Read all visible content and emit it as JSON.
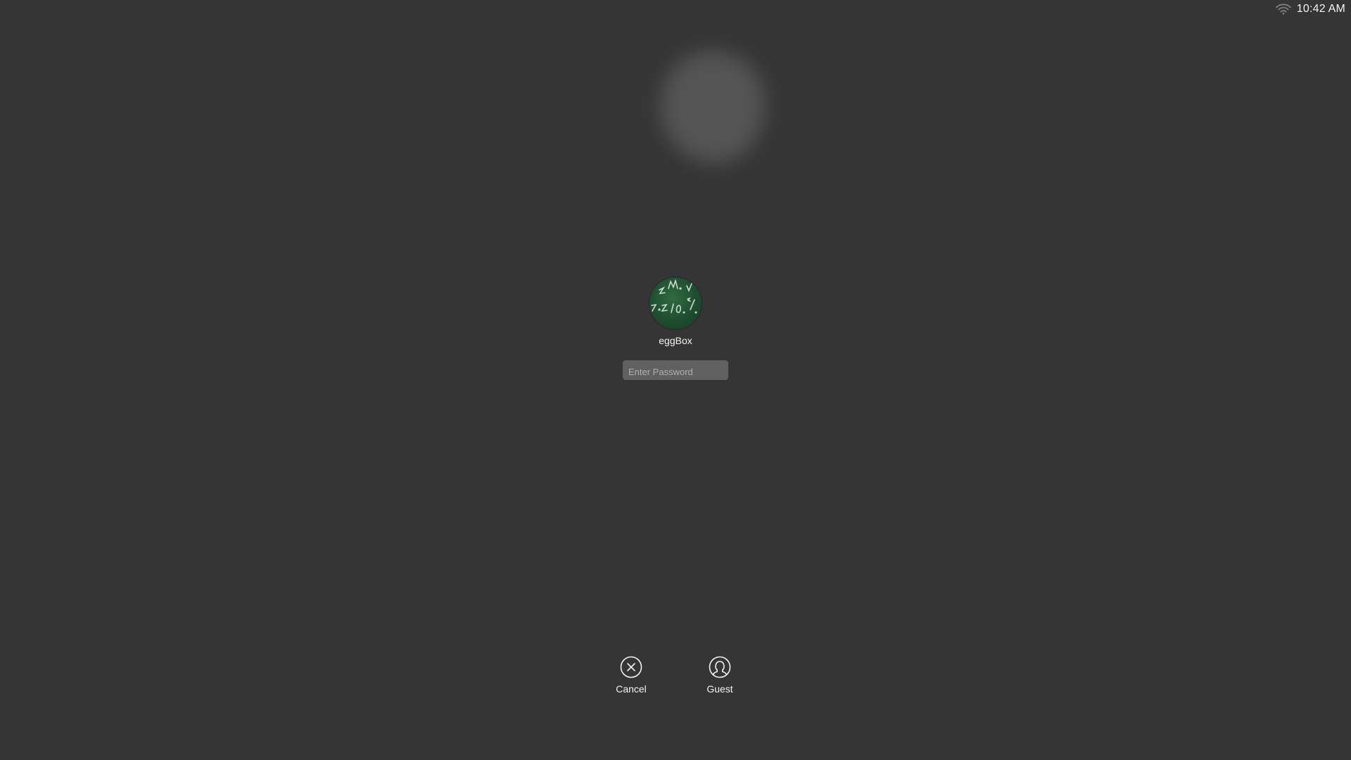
{
  "status_bar": {
    "wifi_icon": "wifi-icon",
    "clock": "10:42 AM"
  },
  "user": {
    "name": "eggBox",
    "avatar_icon": "chalkboard-avatar"
  },
  "password": {
    "placeholder": "Enter Password",
    "value": ""
  },
  "actions": {
    "cancel": {
      "label": "Cancel",
      "icon": "cancel-circle-icon"
    },
    "guest": {
      "label": "Guest",
      "icon": "guest-user-icon"
    }
  },
  "colors": {
    "background": "#353535",
    "field": "#606060",
    "text": "#f4f4f4"
  }
}
